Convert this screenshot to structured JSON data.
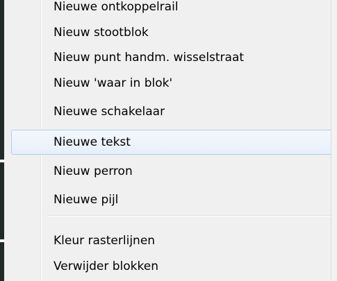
{
  "menu": {
    "items": [
      {
        "label": "Nieuwe ontkoppelrail"
      },
      {
        "label": "Nieuw stootblok"
      },
      {
        "label": "Nieuw punt handm. wisselstraat"
      },
      {
        "label": "Nieuw 'waar in blok'"
      },
      {
        "label": "Nieuwe schakelaar"
      },
      {
        "label": "Nieuwe tekst"
      },
      {
        "label": "Nieuw perron"
      },
      {
        "label": "Nieuwe pijl"
      },
      {
        "label": "Kleur rasterlijnen"
      },
      {
        "label": "Verwijder blokken"
      }
    ],
    "highlighted_item": "Nieuwe tekst",
    "colors": {
      "highlight_border": "#aecff7",
      "highlight_fill": "#e6effa",
      "menu_background": "#f0f0f0"
    }
  }
}
